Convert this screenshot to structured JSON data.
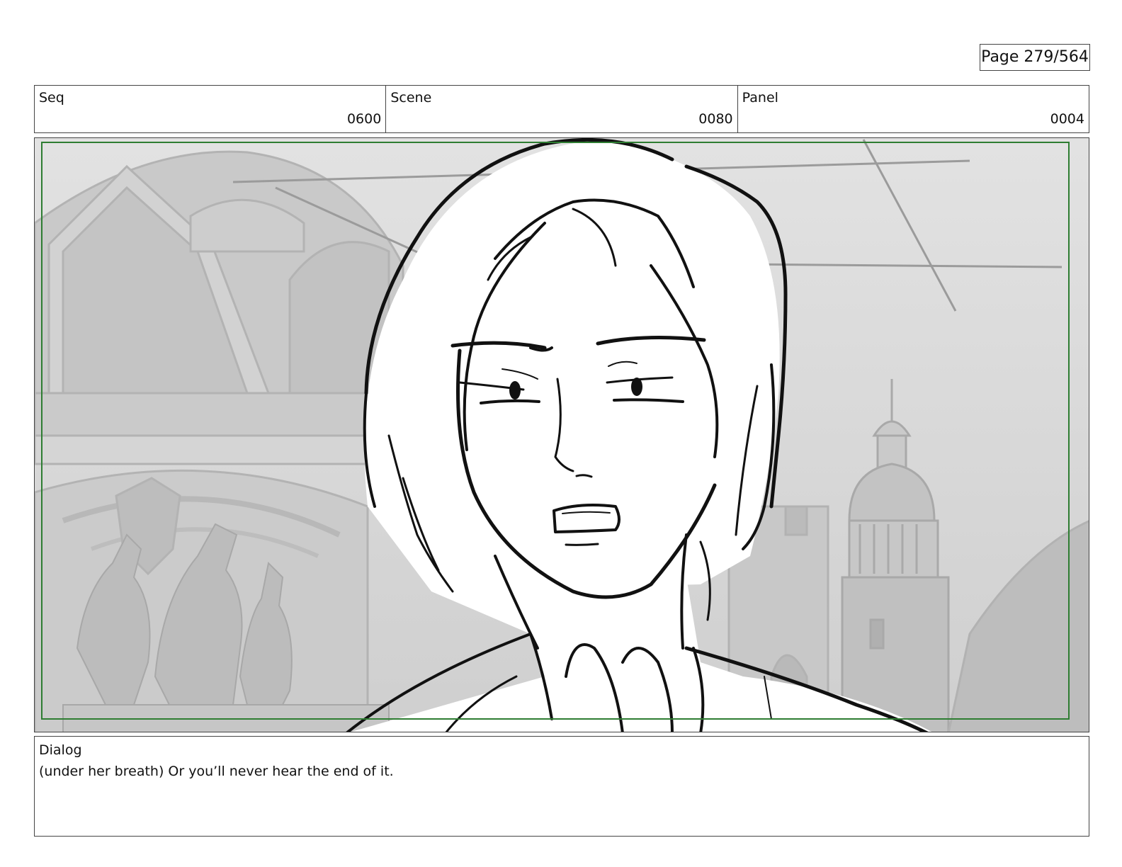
{
  "page": {
    "label": "Page 279/564"
  },
  "header": {
    "seq": {
      "label": "Seq",
      "value": "0600"
    },
    "scene": {
      "label": "Scene",
      "value": "0080"
    },
    "panel": {
      "label": "Panel",
      "value": "0004"
    }
  },
  "frame": {
    "safe_area_color": "#2e7d32",
    "background_tone": "#d8d8d8"
  },
  "dialog": {
    "label": "Dialog",
    "text": "(under her breath) Or you’ll never hear the end of it."
  }
}
